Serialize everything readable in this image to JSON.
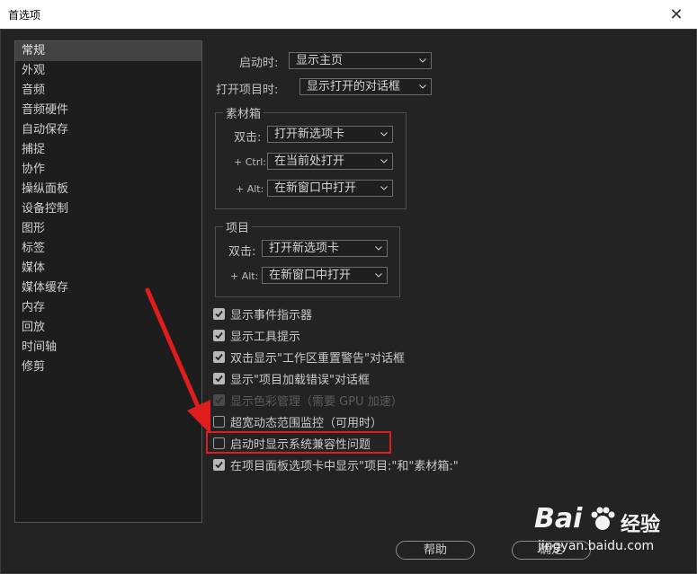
{
  "window": {
    "title": "首选项",
    "close_glyph": "✕"
  },
  "sidebar": {
    "items": [
      "常规",
      "外观",
      "音频",
      "音频硬件",
      "自动保存",
      "捕捉",
      "协作",
      "操纵面板",
      "设备控制",
      "图形",
      "标签",
      "媒体",
      "媒体缓存",
      "内存",
      "回放",
      "时间轴",
      "修剪"
    ],
    "selected": "常规"
  },
  "startup": {
    "label": "启动时:",
    "value": "显示主页"
  },
  "open_project": {
    "label": "打开项目时:",
    "value": "显示打开的对话框"
  },
  "bins": {
    "title": "素材箱",
    "double_click": {
      "label": "双击:",
      "value": "打开新选项卡"
    },
    "ctrl": {
      "label": "+ Ctrl:",
      "value": "在当前处打开"
    },
    "alt": {
      "label": "+ Alt:",
      "value": "在新窗口中打开"
    }
  },
  "project": {
    "title": "项目",
    "double_click": {
      "label": "双击:",
      "value": "打开新选项卡"
    },
    "alt": {
      "label": "+ Alt:",
      "value": "在新窗口中打开"
    }
  },
  "checkboxes": [
    {
      "label": "显示事件指示器",
      "state": "checked"
    },
    {
      "label": "显示工具提示",
      "state": "checked"
    },
    {
      "label": "双击显示\"工作区重置警告\"对话框",
      "state": "checked"
    },
    {
      "label": "显示\"项目加载错误\"对话框",
      "state": "checked"
    },
    {
      "label": "显示色彩管理（需要 GPU 加速）",
      "state": "disabled"
    },
    {
      "label": "超宽动态范围监控（可用时）",
      "state": "unchecked"
    },
    {
      "label": "启动时显示系统兼容性问题",
      "state": "unchecked"
    },
    {
      "label": "在项目面板选项卡中显示\"项目:\"和\"素材箱:\"",
      "state": "checked"
    }
  ],
  "buttons": {
    "help": "帮助",
    "ok": "确定"
  },
  "watermark": {
    "brand": "Bai",
    "brand_suffix": "经验",
    "url": "jingyan.baidu.com"
  },
  "colors": {
    "highlight": "#e01d1d",
    "arrow": "#e01d1d",
    "background": "#232323"
  },
  "icons": {
    "close": "close-icon",
    "dropdown": "chevron-down-icon",
    "check": "check-icon",
    "arrow": "red-arrow-annotation"
  }
}
